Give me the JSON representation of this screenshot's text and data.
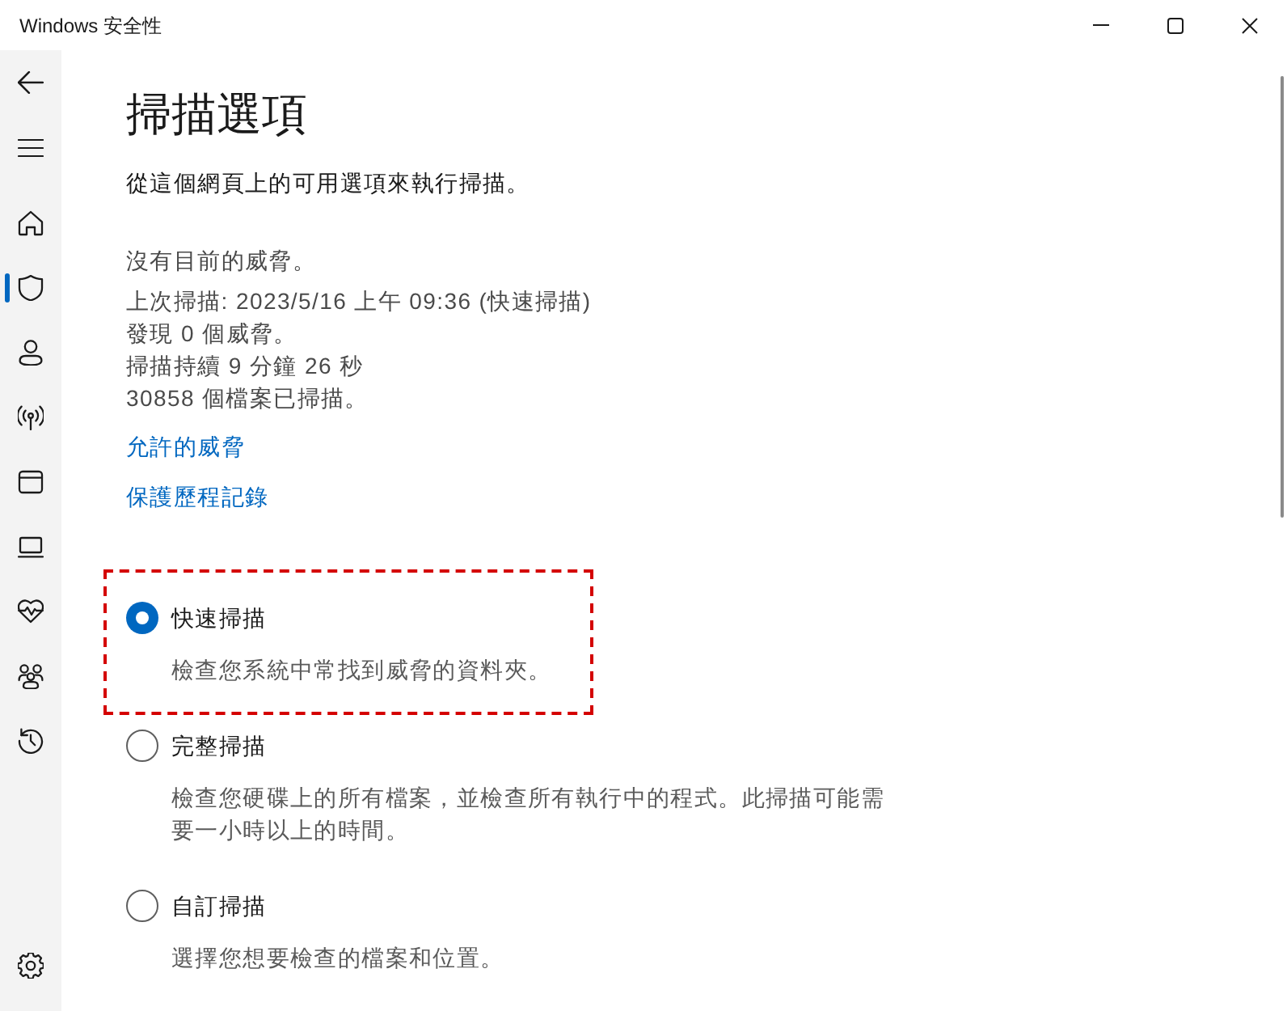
{
  "window": {
    "title": "Windows 安全性"
  },
  "sidebar": {
    "items": [
      {
        "kind": "home",
        "selected": false
      },
      {
        "kind": "shield",
        "selected": true
      },
      {
        "kind": "account",
        "selected": false
      },
      {
        "kind": "network",
        "selected": false
      },
      {
        "kind": "app",
        "selected": false
      },
      {
        "kind": "device",
        "selected": false
      },
      {
        "kind": "health",
        "selected": false
      },
      {
        "kind": "family",
        "selected": false
      },
      {
        "kind": "history",
        "selected": false
      }
    ]
  },
  "page": {
    "title": "掃描選項",
    "subtitle": "從這個網頁上的可用選項來執行掃描。",
    "threat_status": "沒有目前的威脅。",
    "scan_details": [
      "上次掃描: 2023/5/16 上午 09:36 (快速掃描)",
      "發現 0 個威脅。",
      "掃描持續 9 分鐘 26 秒",
      "30858 個檔案已掃描。"
    ],
    "links": [
      "允許的威脅",
      "保護歷程記錄"
    ]
  },
  "scan_options": [
    {
      "label": "快速掃描",
      "description": "檢查您系統中常找到威脅的資料夾。",
      "selected": true,
      "highlighted": true
    },
    {
      "label": "完整掃描",
      "description": "檢查您硬碟上的所有檔案，並檢查所有執行中的程式。此掃描可能需要一小時以上的時間。",
      "selected": false,
      "highlighted": false
    },
    {
      "label": "自訂掃描",
      "description": "選擇您想要檢查的檔案和位置。",
      "selected": false,
      "highlighted": false
    }
  ]
}
